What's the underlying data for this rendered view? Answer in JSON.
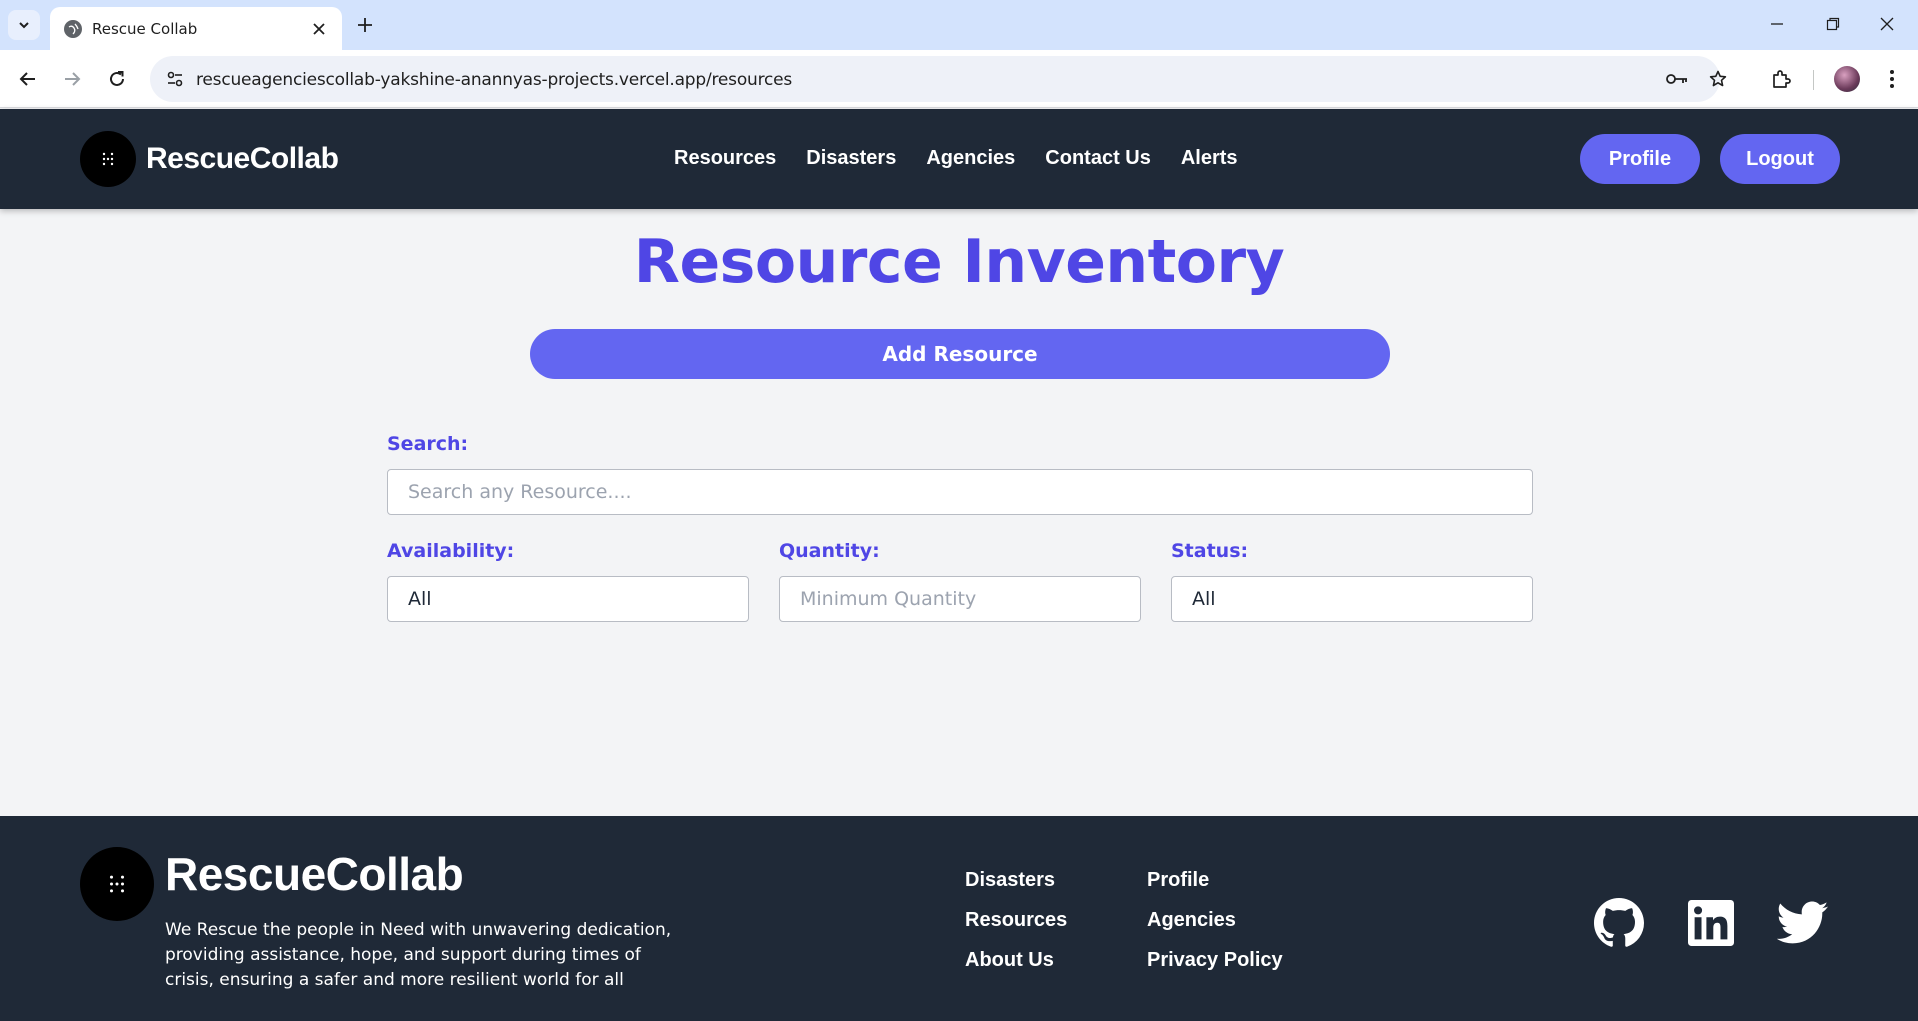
{
  "browser": {
    "tab_title": "Rescue Collab",
    "url": "rescueagenciescollab-yakshine-anannyas-projects.vercel.app/resources"
  },
  "header": {
    "brand": "RescueCollab",
    "nav": [
      "Resources",
      "Disasters",
      "Agencies",
      "Contact Us",
      "Alerts"
    ],
    "profile_label": "Profile",
    "logout_label": "Logout"
  },
  "main": {
    "title": "Resource Inventory",
    "add_button": "Add Resource",
    "search_label": "Search:",
    "search_placeholder": "Search any Resource....",
    "availability_label": "Availability:",
    "availability_value": "All",
    "quantity_label": "Quantity:",
    "quantity_placeholder": "Minimum Quantity",
    "status_label": "Status:",
    "status_value": "All"
  },
  "footer": {
    "brand": "RescueCollab",
    "description": "We Rescue the people in Need with unwavering dedication, providing assistance, hope, and support during times of crisis, ensuring a safer and more resilient world for all",
    "links_col1": [
      "Disasters",
      "Resources",
      "About Us"
    ],
    "links_col2": [
      "Profile",
      "Agencies",
      "Privacy Policy"
    ],
    "social_icons": [
      "github-icon",
      "linkedin-icon",
      "twitter-icon"
    ]
  },
  "colors": {
    "accent": "#6366f1",
    "title": "#4f46e5",
    "dark_bg": "#1f2937",
    "page_bg": "#f3f4f6"
  }
}
